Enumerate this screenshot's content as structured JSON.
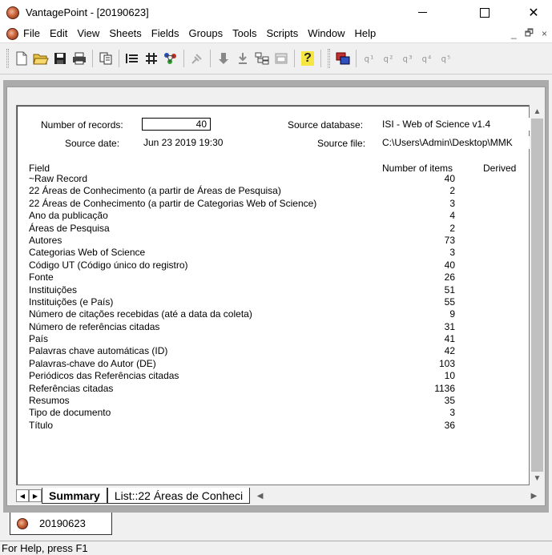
{
  "window": {
    "title": "VantagePoint - [20190623]"
  },
  "menu": [
    "File",
    "Edit",
    "View",
    "Sheets",
    "Fields",
    "Groups",
    "Tools",
    "Scripts",
    "Window",
    "Help"
  ],
  "mdi_controls": {
    "minimize": "_",
    "restore": "🗗",
    "close": "×"
  },
  "toolbar": {
    "help_glyph": "?",
    "groups": [
      "q¹",
      "q²",
      "q³",
      "q⁴",
      "q⁵"
    ]
  },
  "summary": {
    "num_records_label": "Number of records:",
    "num_records_value": "40",
    "source_database_label": "Source database:",
    "source_database_value": "ISI - Web of Science v1.4",
    "source_date_label": "Source date:",
    "source_date_value": "Jun 23 2019 19:30",
    "source_file_label": "Source file:",
    "source_file_value": "C:\\Users\\Admin\\Desktop\\MMK",
    "col_field": "Field",
    "col_items": "Number of items",
    "col_derived": "Derived",
    "rows": [
      {
        "field": "~Raw Record",
        "items": "40"
      },
      {
        "field": "22 Áreas de Conhecimento (a partir de Áreas de Pesquisa)",
        "items": "2"
      },
      {
        "field": "22 Áreas de Conhecimento (a partir de Categorias Web of Science)",
        "items": "3"
      },
      {
        "field": "Ano da publicação",
        "items": "4"
      },
      {
        "field": "Áreas de Pesquisa",
        "items": "2"
      },
      {
        "field": "Autores",
        "items": "73"
      },
      {
        "field": "Categorias Web of Science",
        "items": "3"
      },
      {
        "field": "Código UT (Código único do registro)",
        "items": "40"
      },
      {
        "field": "Fonte",
        "items": "26"
      },
      {
        "field": "Instituições",
        "items": "51"
      },
      {
        "field": "Instituições (e País)",
        "items": "55"
      },
      {
        "field": "Número de citações recebidas (até a data da coleta)",
        "items": "9"
      },
      {
        "field": "Número de referências citadas",
        "items": "31"
      },
      {
        "field": "País",
        "items": "41"
      },
      {
        "field": "Palavras chave automáticas (ID)",
        "items": "42"
      },
      {
        "field": "Palavras-chave do Autor (DE)",
        "items": "103"
      },
      {
        "field": "Periódicos das Referências citadas",
        "items": "10"
      },
      {
        "field": "Referências citadas",
        "items": "1136"
      },
      {
        "field": "Resumos",
        "items": "35"
      },
      {
        "field": "Tipo de documento",
        "items": "3"
      },
      {
        "field": "Título",
        "items": "36"
      }
    ]
  },
  "sheet_tabs": {
    "active": "Summary",
    "second": "List::22 Áreas de Conheci"
  },
  "doc_tab": "20190623",
  "status": "For Help, press F1"
}
